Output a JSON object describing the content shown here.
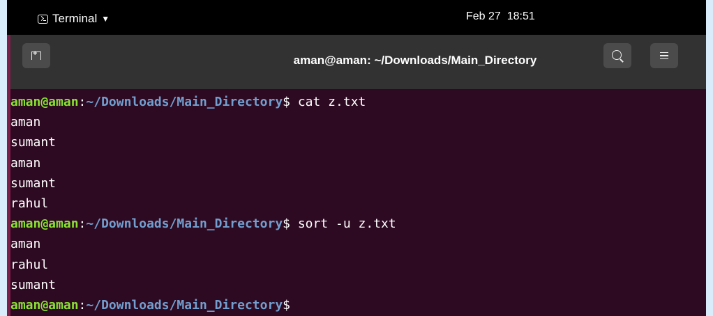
{
  "topbar": {
    "app_name": "Terminal",
    "date": "Feb 27",
    "time": "18:51"
  },
  "window": {
    "title": "aman@aman: ~/Downloads/Main_Directory"
  },
  "prompt": {
    "user_host": "aman@aman",
    "separator": ":",
    "path": "~/Downloads/Main_Directory",
    "symbol": "$"
  },
  "commands": [
    {
      "text": " cat z.txt",
      "output": [
        "aman",
        "sumant",
        "aman",
        "sumant",
        "rahul"
      ]
    },
    {
      "text": " sort -u z.txt",
      "output": [
        "aman",
        "rahul",
        "sumant"
      ]
    },
    {
      "text": "",
      "output": []
    }
  ],
  "icons": {
    "app_icon": "terminal-icon",
    "dropdown": "chevron-down-icon",
    "new_tab": "new-tab-icon",
    "search": "search-icon",
    "menu": "hamburger-menu-icon"
  },
  "colors": {
    "terminal_bg": "#2d0a22",
    "prompt_user": "#8ae234",
    "prompt_path": "#729fcf",
    "headerbar": "#323232"
  }
}
